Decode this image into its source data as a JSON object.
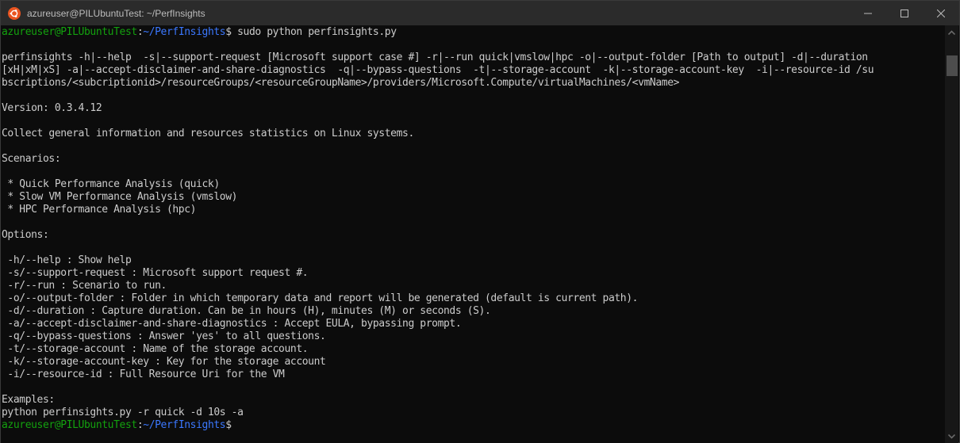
{
  "window": {
    "title": "azureuser@PILUbuntuTest: ~/PerfInsights",
    "icon": "ubuntu-logo-icon",
    "controls": [
      "minimize-icon",
      "maximize-icon",
      "close-icon"
    ]
  },
  "terminal": {
    "prompt": {
      "user_host": "azureuser@PILUbuntuTest",
      "separator": ":",
      "cwd": "~/PerfInsights",
      "symbol": "$"
    },
    "command": " sudo python perfinsights.py",
    "output": [
      "",
      "perfinsights -h|--help  -s|--support-request [Microsoft support case #] -r|--run quick|vmslow|hpc -o|--output-folder [Path to output] -d|--duration",
      "[xH|xM|xS] -a|--accept-disclaimer-and-share-diagnostics  -q|--bypass-questions  -t|--storage-account  -k|--storage-account-key  -i|--resource-id /su",
      "bscriptions/<subcriptionid>/resourceGroups/<resourceGroupName>/providers/Microsoft.Compute/virtualMachines/<vmName>",
      "",
      "Version: 0.3.4.12",
      "",
      "Collect general information and resources statistics on Linux systems.",
      "",
      "Scenarios:",
      "",
      " * Quick Performance Analysis (quick)",
      " * Slow VM Performance Analysis (vmslow)",
      " * HPC Performance Analysis (hpc)",
      "",
      "Options:",
      "",
      " -h/--help : Show help",
      " -s/--support-request : Microsoft support request #.",
      " -r/--run : Scenario to run.",
      " -o/--output-folder : Folder in which temporary data and report will be generated (default is current path).",
      " -d/--duration : Capture duration. Can be in hours (H), minutes (M) or seconds (S).",
      " -a/--accept-disclaimer-and-share-diagnostics : Accept EULA, bypassing prompt.",
      " -q/--bypass-questions : Answer 'yes' to all questions.",
      " -t/--storage-account : Name of the storage account.",
      " -k/--storage-account-key : Key for the storage account",
      " -i/--resource-id : Full Resource Uri for the VM",
      "",
      "Examples:",
      "python perfinsights.py -r quick -d 10s -a"
    ],
    "colors": {
      "background": "#0c0c0c",
      "foreground": "#cccccc",
      "user_host": "#13a10e",
      "cwd": "#3b78ff"
    }
  }
}
